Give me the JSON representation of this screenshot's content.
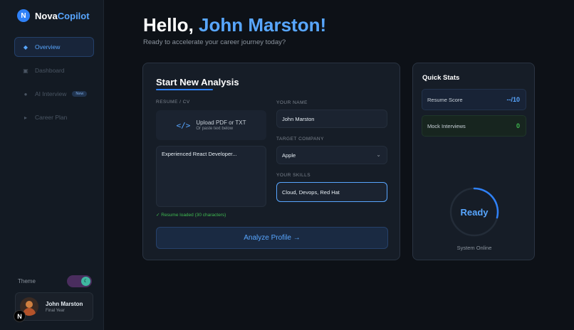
{
  "app": {
    "logo_letter": "N",
    "name_part1": "Nova",
    "name_part2": "Copilot",
    "accent_color": "#58a6ff"
  },
  "sidebar": {
    "items": [
      {
        "label": "Overview",
        "icon": "diamond-icon",
        "active": true
      },
      {
        "label": "Dashboard",
        "icon": "grid-icon",
        "active": false
      },
      {
        "label": "AI Interview",
        "icon": "dot-icon",
        "active": false,
        "badge": "New"
      },
      {
        "label": "Career Plan",
        "icon": "arrow-icon",
        "active": false
      }
    ],
    "theme_label": "Theme",
    "theme_toggle_icon": "moon-icon",
    "user": {
      "name": "John Marston",
      "role": "Final Year"
    },
    "framework_badge": "N"
  },
  "header": {
    "greeting_prefix": "Hello,",
    "greeting_name": "John Marston!",
    "subtitle": "Ready to accelerate your career journey today?"
  },
  "analysis": {
    "title": "Start New Analysis",
    "resume_label": "RESUME / CV",
    "upload_title": "Upload PDF or TXT",
    "upload_sub": "Or paste text below",
    "resume_text": "Experienced React Developer...",
    "loaded_status": "✓ Resume loaded (30 characters)",
    "name_label": "YOUR NAME",
    "name_value": "John Marston",
    "company_label": "TARGET COMPANY",
    "company_value": "Apple",
    "skills_label": "YOUR SKILLS",
    "skills_value": "Cloud, Devops, Red Hat",
    "analyze_button": "Analyze Profile →"
  },
  "stats": {
    "title": "Quick Stats",
    "resume_score_label": "Resume Score",
    "resume_score_value": "--/10",
    "mock_interviews_label": "Mock Interviews",
    "mock_interviews_value": "0",
    "ring_text": "Ready",
    "system_status": "System Online"
  }
}
